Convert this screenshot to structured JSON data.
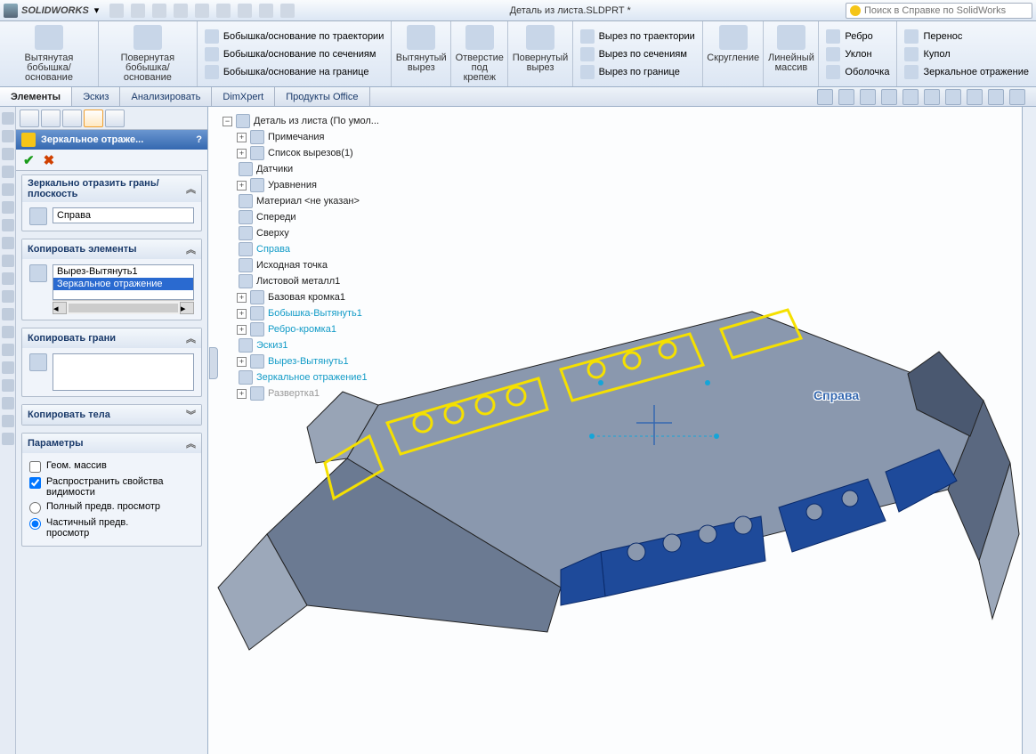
{
  "app": {
    "name": "SOLIDWORKS",
    "title": "Деталь из листа.SLDPRT *"
  },
  "search": {
    "placeholder": "Поиск в Справке по SolidWorks"
  },
  "ribbon": {
    "extrudedBoss": "Вытянутая\nбобышка/основание",
    "revolvedBoss": "Повернутая\nбобышка/основание",
    "sweptBoss": "Бобышка/основание по траектории",
    "loftedBoss": "Бобышка/основание по сечениям",
    "boundaryBoss": "Бобышка/основание на границе",
    "extrudedCut": "Вытянутый\nвырез",
    "holeWizard": "Отверстие\nпод\nкрепеж",
    "revolvedCut": "Повернутый\nвырез",
    "sweptCut": "Вырез по траектории",
    "loftedCut": "Вырез по сечениям",
    "boundaryCut": "Вырез по границе",
    "fillet": "Скругление",
    "linearPattern": "Линейный\nмассив",
    "rib": "Ребро",
    "draft": "Уклон",
    "shell": "Оболочка",
    "wrap": "Перенос",
    "dome": "Купол",
    "mirror": "Зеркальное отражение"
  },
  "tabs": {
    "features": "Элементы",
    "sketch": "Эскиз",
    "evaluate": "Анализировать",
    "dimxpert": "DimXpert",
    "office": "Продукты Office"
  },
  "propPanel": {
    "title": "Зеркальное отраже...",
    "group1": {
      "title": "Зеркально отразить грань/плоскость",
      "value": "Справа"
    },
    "group2": {
      "title": "Копировать элементы",
      "item1": "Вырез-Вытянуть1",
      "item2": "Зеркальное отражение"
    },
    "group3": {
      "title": "Копировать грани"
    },
    "group4": {
      "title": "Копировать тела"
    },
    "params": {
      "title": "Параметры",
      "geom": "Геом. массив",
      "propagate": "Распространить свойства видимости",
      "fullPrev": "Полный предв. просмотр",
      "partialPrev": "Частичный предв. просмотр"
    }
  },
  "tree": {
    "root": "Деталь из листа  (По умол...",
    "annotations": "Примечания",
    "cutlist": "Список вырезов(1)",
    "sensors": "Датчики",
    "equations": "Уравнения",
    "material": "Материал <не указан>",
    "front": "Спереди",
    "top": "Сверху",
    "right": "Справа",
    "origin": "Исходная точка",
    "sheetmetal": "Листовой металл1",
    "baseFlange": "Базовая кромка1",
    "bossExtrude": "Бобышка-Вытянуть1",
    "edgeFlange": "Ребро-кромка1",
    "sketch": "Эскиз1",
    "cutExtrude": "Вырез-Вытянуть1",
    "mirror": "Зеркальное отражение1",
    "flatPattern": "Развертка1"
  },
  "planeLabel": "Справа"
}
